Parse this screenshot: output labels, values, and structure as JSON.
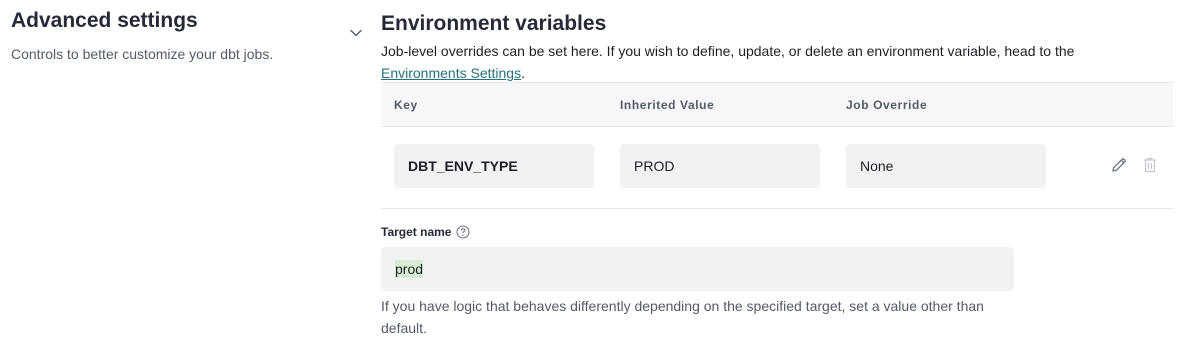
{
  "advanced": {
    "title": "Advanced settings",
    "description": "Controls to better customize your dbt jobs.",
    "collapse_icon": "chevron-down-icon"
  },
  "env_vars": {
    "title": "Environment variables",
    "description": "Job-level overrides can be set here. If you wish to define, update, or delete an environment variable, head to the",
    "link_text": "Environments Settings",
    "link_suffix": ".",
    "columns": [
      "Key",
      "Inherited Value",
      "Job Override"
    ],
    "rows": [
      {
        "key": "DBT_ENV_TYPE",
        "inherited": "PROD",
        "override": "None"
      }
    ],
    "row_icons": [
      "pencil-icon",
      "trash-icon"
    ]
  },
  "target": {
    "label": "Target name",
    "value": "prod",
    "help": "If you have logic that behaves differently depending on the specified target, set a value other than default."
  },
  "colors": {
    "link": "#26717f",
    "text": "#262a38",
    "muted": "#545a6b",
    "field_bg": "#f1f2f4",
    "highlight": "#d7ecd4"
  }
}
